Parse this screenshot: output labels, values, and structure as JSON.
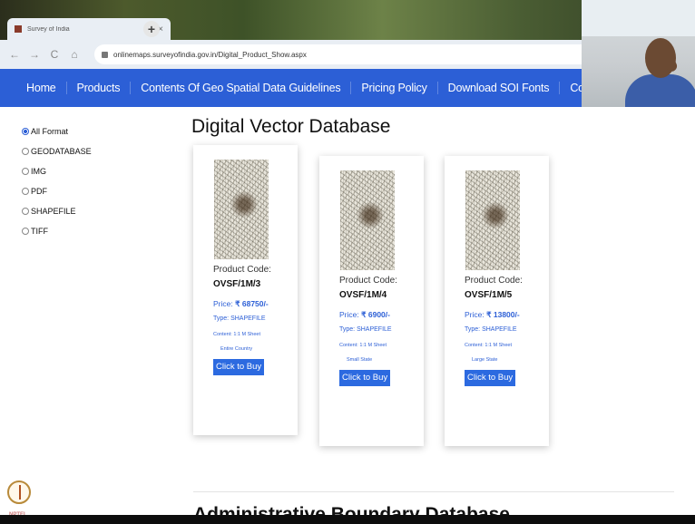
{
  "browser": {
    "tab_title": "Survey of India",
    "tab_close": "×",
    "new_tab": "+",
    "url": "onlinemaps.surveyofindia.gov.in/Digital_Product_Show.aspx",
    "back": "←",
    "forward": "→",
    "reload": "C",
    "home": "⌂"
  },
  "nav": {
    "items": [
      "Home",
      "Products",
      "Contents Of Geo Spatial Data Guidelines",
      "Pricing Policy",
      "Download SOI Fonts",
      "Contact Us"
    ]
  },
  "filters": {
    "options": [
      {
        "label": "All Format",
        "selected": true
      },
      {
        "label": "GEODATABASE",
        "selected": false
      },
      {
        "label": "IMG",
        "selected": false
      },
      {
        "label": "PDF",
        "selected": false
      },
      {
        "label": "SHAPEFILE",
        "selected": false
      },
      {
        "label": "TIFF",
        "selected": false
      }
    ]
  },
  "main": {
    "title": "Digital Vector Database",
    "next_section_title": "Administrative Boundary Database",
    "products": [
      {
        "code_label": "Product Code:",
        "code": "OVSF/1M/3",
        "price_label": "Price:",
        "price": "₹ 68750/-",
        "type": "Type: SHAPEFILE",
        "content": "Content: 1:1 M Sheet",
        "coverage": "Entire Country",
        "buy": "Click to Buy"
      },
      {
        "code_label": "Product Code:",
        "code": "OVSF/1M/4",
        "price_label": "Price:",
        "price": "₹ 6900/-",
        "type": "Type: SHAPEFILE",
        "content": "Content: 1:1 M Sheet",
        "coverage": "Small State",
        "buy": "Click to Buy"
      },
      {
        "code_label": "Product Code:",
        "code": "OVSF/1M/5",
        "price_label": "Price:",
        "price": "₹ 13800/-",
        "type": "Type: SHAPEFILE",
        "content": "Content: 1:1 M Sheet",
        "coverage": "Large State",
        "buy": "Click to Buy"
      }
    ]
  },
  "overlay": {
    "nptel": "NPTEL"
  },
  "colors": {
    "nav_bg": "#2c5fd6",
    "price_blue": "#2c5fd6",
    "button_blue": "#2c6ae0"
  },
  "icons": [
    "back-icon",
    "forward-icon",
    "reload-icon",
    "home-icon",
    "lock-icon",
    "favicon-icon",
    "nptel-logo-icon"
  ]
}
